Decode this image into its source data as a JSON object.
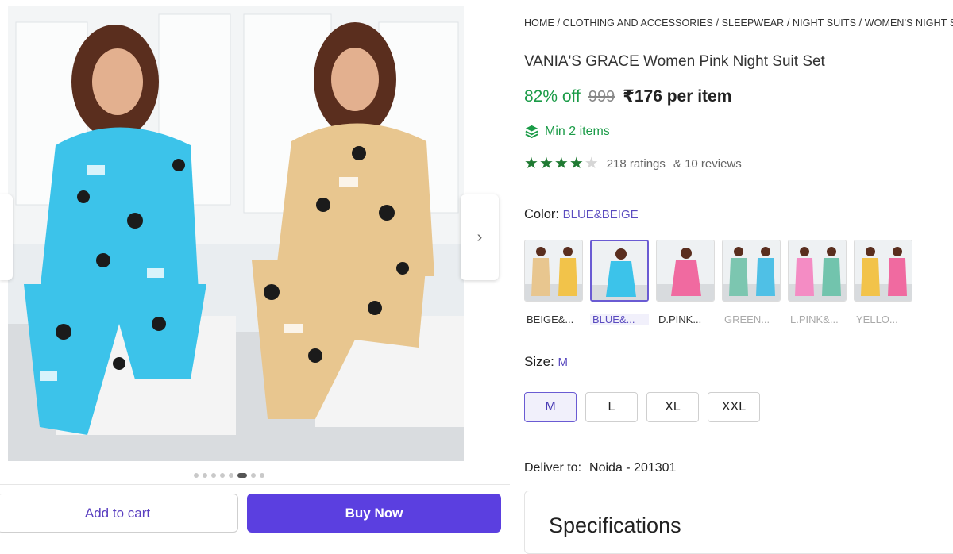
{
  "breadcrumb": {
    "text": "HOME / CLOTHING AND ACCESSORIES / SLEEPWEAR / NIGHT SUITS / WOMEN'S NIGHT SUITS /"
  },
  "product": {
    "title": "VANIA'S GRACE Women Pink Night Suit Set",
    "discount": "82% off",
    "mrp": "999",
    "price": "₹176 per item",
    "min_items": "Min 2 items",
    "rating_stars": 4,
    "rating_max": 5,
    "ratings_text": "218 ratings",
    "reviews_text": "& 10 reviews"
  },
  "color": {
    "label": "Color:",
    "selected": "BLUE&BEIGE",
    "options": [
      {
        "label": "BEIGE&...",
        "a": "#e8c68f",
        "b": "#f2c34a"
      },
      {
        "label": "BLUE&...",
        "a": "#3cc3ea",
        "b": "#3cc3ea"
      },
      {
        "label": "D.PINK...",
        "a": "#f06aa0",
        "b": "#f06aa0"
      },
      {
        "label": "GREEN...",
        "a": "#7cc6b0",
        "b": "#4fc0e6"
      },
      {
        "label": "L.PINK&...",
        "a": "#f48cc4",
        "b": "#72c4ad"
      },
      {
        "label": "YELLO...",
        "a": "#f2c34a",
        "b": "#f06aa0"
      }
    ]
  },
  "size": {
    "label": "Size:",
    "selected": "M",
    "options": [
      "M",
      "L",
      "XL",
      "XXL"
    ]
  },
  "delivery": {
    "label": "Deliver to:",
    "location": "Noida - 201301"
  },
  "specifications": {
    "title": "Specifications"
  },
  "actions": {
    "add_to_cart": "Add to cart",
    "buy_now": "Buy Now"
  },
  "gallery": {
    "image_count": 8,
    "active_index": 6,
    "next_icon": "chevron-right-icon"
  },
  "colors": {
    "accent": "#5b3fe0",
    "green": "#1a9b47",
    "star": "#1f7a32"
  }
}
